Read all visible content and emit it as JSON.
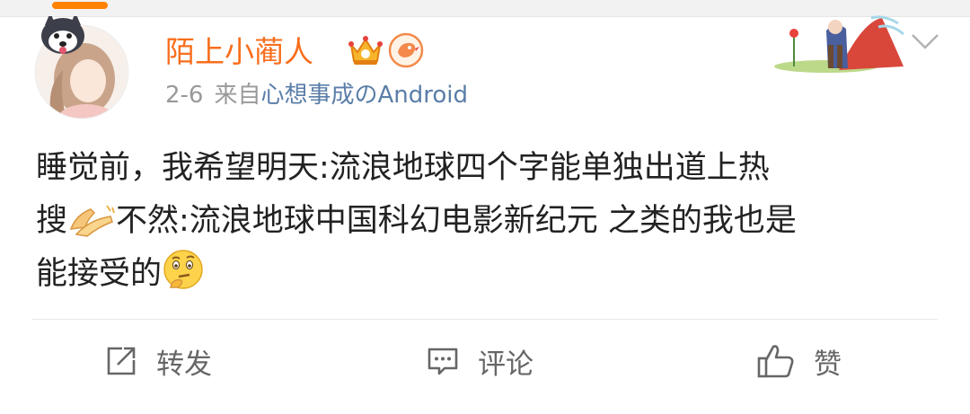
{
  "post": {
    "username": "陌上小蔺人",
    "date": "2-6",
    "from_label": "来自",
    "source": "心想事成のAndroid",
    "text_line1": "睡觉前，我希望明天:流浪地球四个字能单独出道上热",
    "text_line2_a": "搜",
    "text_line2_b": "不然:流浪地球中国科幻电影新纪元 之类的我也是",
    "text_line3": "能接受的",
    "emojis": [
      "praying-hands-icon",
      "thinking-face-icon"
    ]
  },
  "actions": {
    "repost_label": "转发",
    "comment_label": "评论",
    "like_label": "赞"
  },
  "colors": {
    "username": "#f86e1c",
    "source_link": "#5a7ea8",
    "meta_text": "#999999",
    "body_text": "#222222",
    "action_text": "#666666",
    "top_accent": "#ff8200"
  }
}
